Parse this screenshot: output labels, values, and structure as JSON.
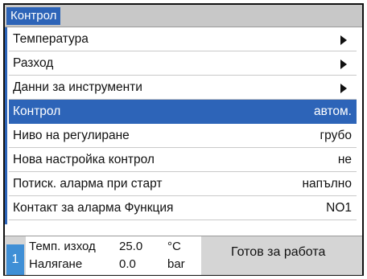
{
  "window": {
    "title": "Контрол"
  },
  "menu": {
    "items": [
      {
        "label": "Температура",
        "value": "",
        "submenu": true,
        "selected": false
      },
      {
        "label": "Разход",
        "value": "",
        "submenu": true,
        "selected": false
      },
      {
        "label": "Данни за инструменти",
        "value": "",
        "submenu": true,
        "selected": false
      },
      {
        "label": "Контрол",
        "value": "автом.",
        "submenu": false,
        "selected": true
      },
      {
        "label": "Ниво на регулиране",
        "value": "грубо",
        "submenu": false,
        "selected": false
      },
      {
        "label": "Нова настройка контрол",
        "value": "не",
        "submenu": false,
        "selected": false
      },
      {
        "label": "Потиск. аларма при старт",
        "value": "напълно",
        "submenu": false,
        "selected": false
      },
      {
        "label": "Контакт за аларма Функция",
        "value": "NO1",
        "submenu": false,
        "selected": false
      }
    ]
  },
  "status": {
    "index": "1",
    "readings": [
      {
        "name": "Темп. изход",
        "value": "25.0",
        "unit": "°C"
      },
      {
        "name": "Налягане",
        "value": "0.0",
        "unit": "bar"
      }
    ],
    "state_text": "Готов за работа"
  },
  "colors": {
    "accent": "#2d64b8",
    "titlebar": "#c8c8c8",
    "status_bg": "#d5d5d5",
    "index_badge": "#3f8fd6"
  }
}
